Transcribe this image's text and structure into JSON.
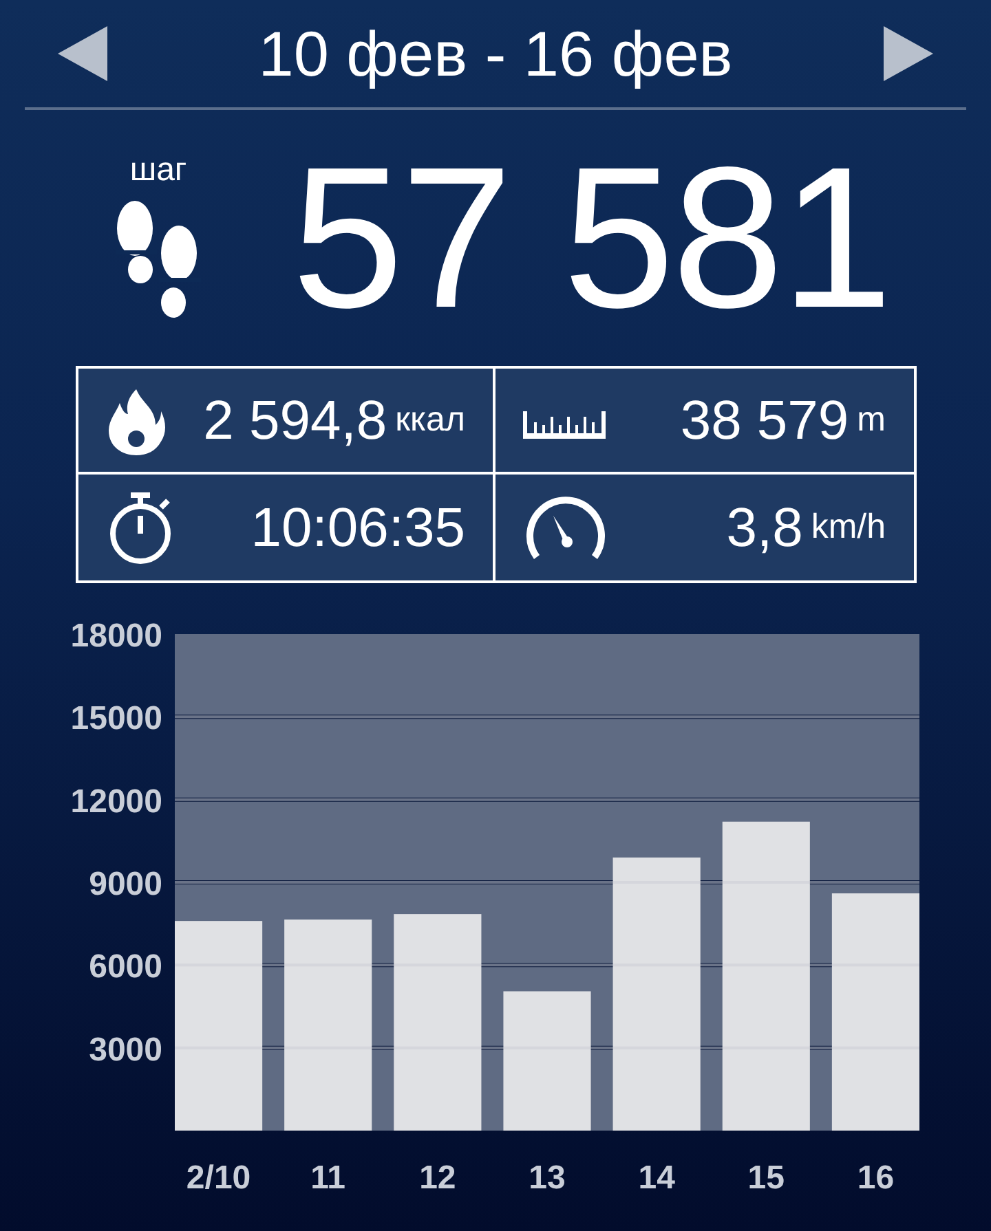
{
  "header": {
    "title": "10 фев - 16 фев"
  },
  "steps": {
    "unit": "шаг",
    "value": "57 581"
  },
  "stats": [
    {
      "kind": "calories",
      "value": "2 594,8",
      "unit": "ккал"
    },
    {
      "kind": "distance",
      "value": "38 579",
      "unit": "m"
    },
    {
      "kind": "duration",
      "value": "10:06:35"
    },
    {
      "kind": "speed",
      "value": "3,8",
      "unit": "km/h"
    }
  ],
  "chart": {
    "chart_data": {
      "type": "bar",
      "categories": [
        "2/10",
        "11",
        "12",
        "13",
        "14",
        "15",
        "16"
      ],
      "values": [
        7600,
        7650,
        7850,
        5050,
        9900,
        11200,
        8600
      ],
      "grid": true,
      "ylim": [
        0,
        18000
      ],
      "yticks": [
        3000,
        6000,
        9000,
        12000,
        15000,
        18000
      ]
    }
  }
}
